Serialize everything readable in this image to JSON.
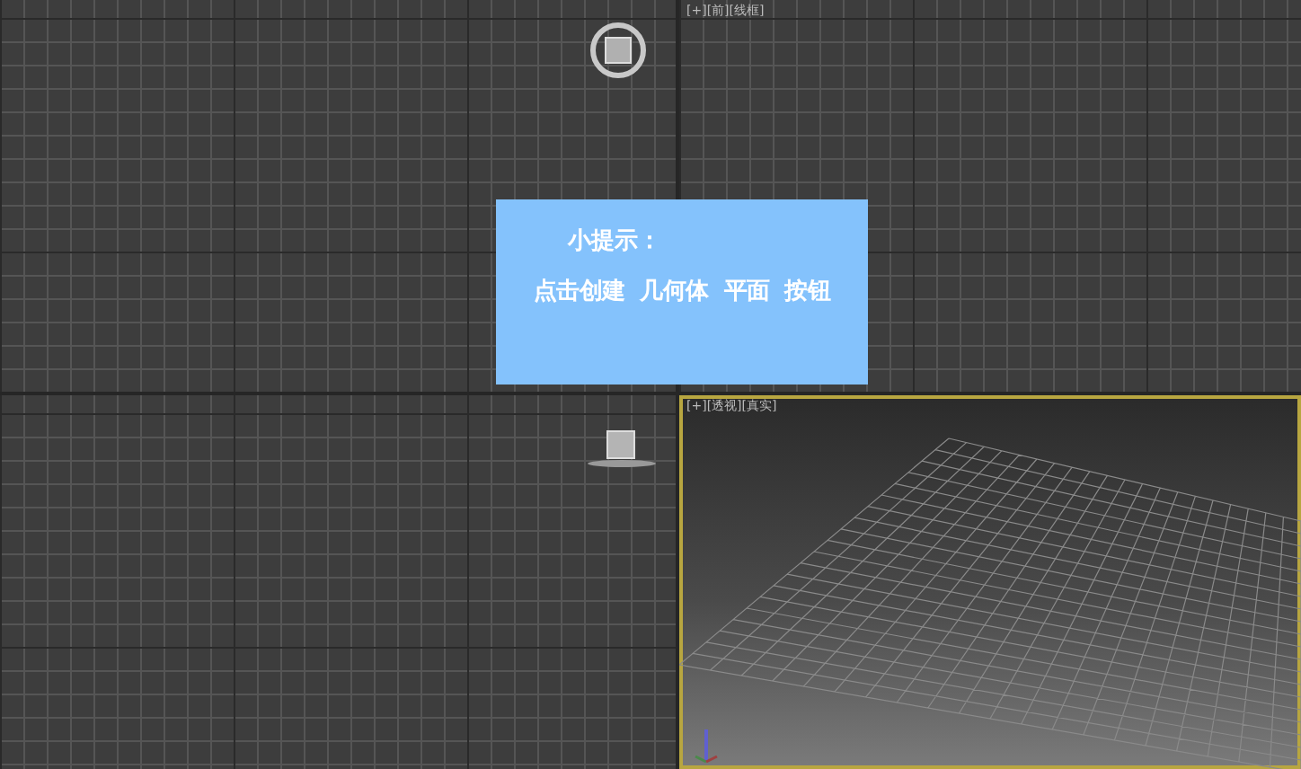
{
  "viewports": [
    {
      "kind": "ortho",
      "active": false,
      "object": {
        "kind": "top"
      }
    },
    {
      "kind": "ortho",
      "label": "[+][前][线框]",
      "active": false
    },
    {
      "kind": "ortho",
      "active": false,
      "object": {
        "kind": "side"
      }
    },
    {
      "kind": "perspective",
      "label": "[+][透视][真实]",
      "active": true
    }
  ],
  "tip": {
    "title": "小提示：",
    "text": "点击创建  几何体  平面  按钮"
  }
}
